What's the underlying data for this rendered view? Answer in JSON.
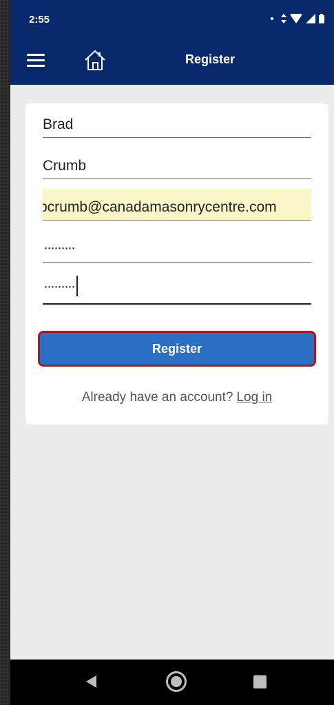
{
  "status_bar": {
    "time": "2:55"
  },
  "app_bar": {
    "title": "Register",
    "menu_icon": "hamburger-menu-icon",
    "home_icon": "home-icon"
  },
  "form": {
    "first_name": "Brad",
    "last_name": "Crumb",
    "email": "bcrumb@canadamasonrycentre.com",
    "password_masked": "·········",
    "confirm_password_masked": "·········",
    "register_label": "Register",
    "login_prompt": "Already have an account?",
    "login_link": "Log in"
  },
  "colors": {
    "app_bar": "#07296b",
    "button": "#2b6fc2",
    "button_border": "#b3141f",
    "autofill": "#fbf6c8"
  }
}
